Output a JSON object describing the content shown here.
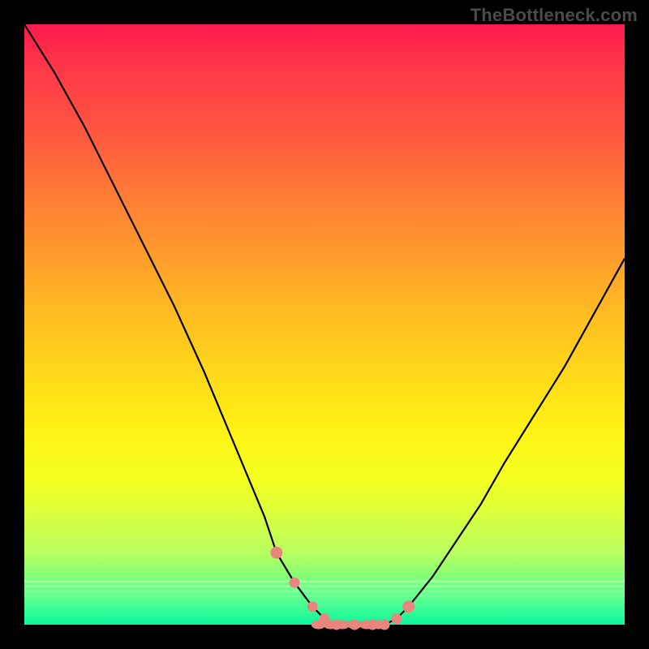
{
  "watermark": "TheBottleneck.com",
  "colors": {
    "frame": "#000000",
    "curve_stroke": "#000000",
    "dot_fill": "#e8857f",
    "gradient_top": "#ff1a4d",
    "gradient_bottom": "#02f79a"
  },
  "chart_data": {
    "type": "line",
    "title": "",
    "xlabel": "",
    "ylabel": "",
    "xlim": [
      0,
      100
    ],
    "ylim": [
      0,
      100
    ],
    "x": [
      0,
      5,
      10,
      15,
      20,
      25,
      30,
      35,
      40,
      42,
      45,
      48,
      50,
      52,
      55,
      58,
      60,
      62,
      64,
      68,
      72,
      76,
      80,
      85,
      90,
      95,
      100
    ],
    "values": [
      100,
      92,
      83,
      73,
      63,
      53,
      42,
      30,
      18,
      12,
      7,
      3,
      1,
      0,
      0,
      0,
      0,
      1,
      3,
      8,
      14,
      20,
      27,
      35,
      43,
      52,
      61
    ],
    "annotations": {
      "dots_x": [
        42,
        45,
        48,
        50,
        52,
        55,
        58,
        60,
        62,
        64
      ],
      "dots_y": [
        12,
        7,
        3,
        1,
        0,
        0,
        0,
        0,
        1,
        3
      ]
    }
  }
}
